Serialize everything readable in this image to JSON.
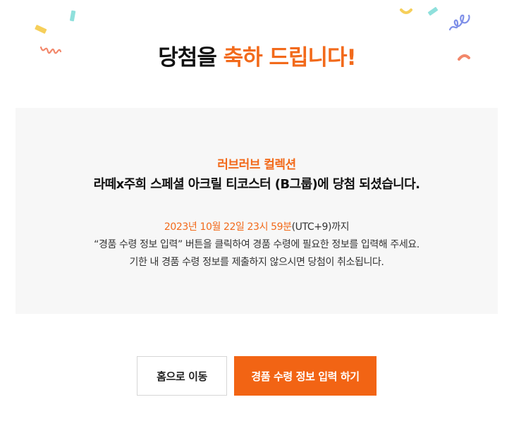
{
  "header": {
    "title_prefix": "당첨을",
    "title_accent": "축하 드립니다!"
  },
  "panel": {
    "collection_name": "러브러브 컬렉션",
    "product_line": "라떼x주희 스페셜 아크릴 티코스터 (B그룹)에 당첨 되셨습니다.",
    "deadline_date": "2023년 10월 22일 23시 59분",
    "deadline_suffix": "(UTC+9)까지",
    "instruction": "“경품 수령 정보 입력” 버튼을 클릭하여 경품 수령에 필요한 정보를 입력해 주세요.",
    "warning": "기한 내 경품 수령 정보를 제출하지 않으시면 당첨이 취소됩니다."
  },
  "buttons": {
    "home_label": "홈으로 이동",
    "submit_label": "경품 수령 정보 입력 하기"
  },
  "colors": {
    "accent": "#f26a1b",
    "primary_button": "#f26414",
    "panel_bg": "#f7f7f7",
    "confetti_yellow": "#f6cf5a",
    "confetti_teal": "#8fe0dc",
    "confetti_coral": "#f2876a",
    "confetti_blue": "#7e8fe8"
  },
  "decorations": [
    "confetti-yellow",
    "confetti-teal",
    "confetti-coral-squiggle",
    "confetti-blue-squiggle",
    "confetti-coral-arc"
  ]
}
